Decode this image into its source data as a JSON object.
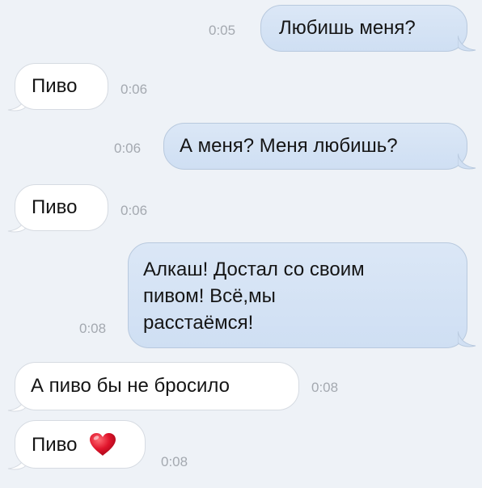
{
  "messages": [
    {
      "direction": "out",
      "text": "Любишь меня?",
      "time": "0:05"
    },
    {
      "direction": "in",
      "text": "Пиво",
      "time": "0:06"
    },
    {
      "direction": "out",
      "text": "А меня? Меня любишь?",
      "time": "0:06"
    },
    {
      "direction": "in",
      "text": "Пиво",
      "time": "0:06"
    },
    {
      "direction": "out",
      "lines": [
        "Алкаш! Достал со своим",
        "пивом! Всё,мы",
        "расстаёмся!"
      ],
      "time": "0:08"
    },
    {
      "direction": "in",
      "text": "А пиво бы не бросило",
      "time": "0:08"
    },
    {
      "direction": "in",
      "text": "Пиво",
      "emoji": "heart-emoji",
      "time": "0:08"
    }
  ],
  "colors": {
    "background": "#eef2f7",
    "outgoing_bubble": "#d3e2f4",
    "incoming_bubble": "#ffffff",
    "time_text": "#a4a9b0",
    "heart": "#e0142b"
  }
}
